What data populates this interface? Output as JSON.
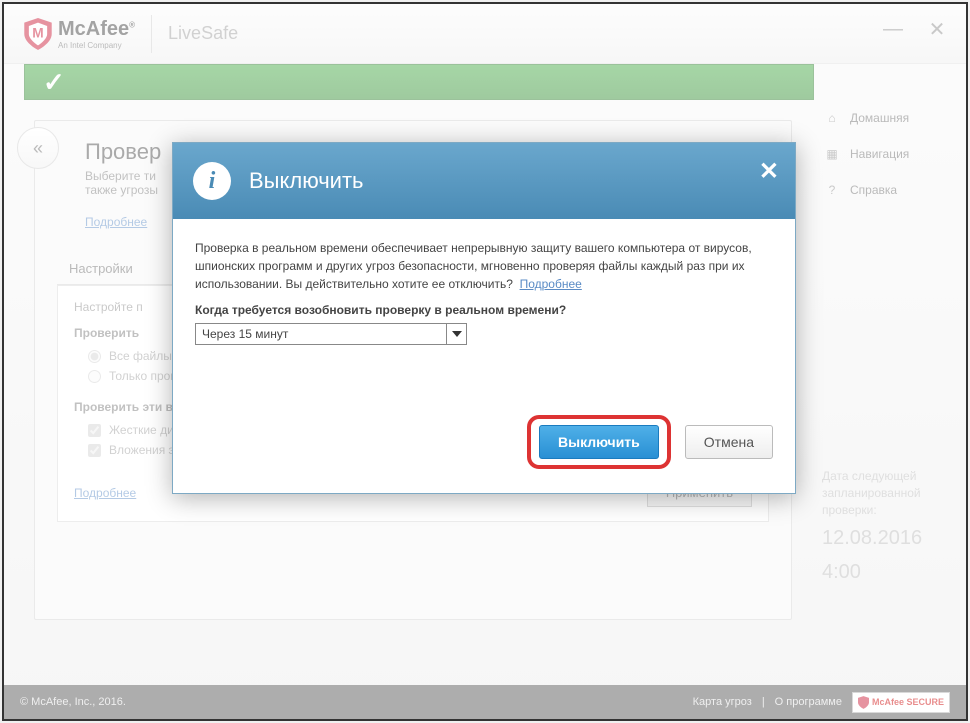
{
  "brand": {
    "name": "McAfee",
    "sub": "An Intel Company",
    "product": "LiveSafe"
  },
  "nav": {
    "home": "Домашняя",
    "navigation": "Навигация",
    "help": "Справка"
  },
  "page": {
    "title_truncated": "Провер",
    "sub1": "Выберите ти",
    "sub2": "также угрозы",
    "learn_more": "Подробнее",
    "tab_settings": "Настройки",
    "settings_lead": "Настройте п",
    "section1": "Проверить",
    "radio_all": "Все файлы (рекомендуется)",
    "radio_only": "Только программы и документы",
    "section2": "Проверить эти вложения и расположения",
    "check_hdd": "Жесткие диски ПК (автоматически)",
    "check_email": "Вложения электронной почты",
    "learn_more2": "Подробнее",
    "apply": "Применить"
  },
  "schedule": {
    "label": "Дата следующей запланированной проверки:",
    "date": "12.08.2016",
    "time": "4:00"
  },
  "footer": {
    "copy": "© McAfee, Inc., 2016.",
    "threats": "Карта угроз",
    "about": "О программе",
    "secure": "McAfee SECURE"
  },
  "modal": {
    "title": "Выключить",
    "para": "Проверка в реальном времени обеспечивает непрерывную защиту вашего компьютера от вирусов, шпионских программ и других угроз безопасности, мгновенно проверяя файлы каждый раз при их использовании. Вы действительно хотите ее отключить?",
    "learn": "Подробнее",
    "question": "Когда требуется возобновить проверку в реальном времени?",
    "select_value": "Через 15 минут",
    "primary": "Выключить",
    "secondary": "Отмена"
  }
}
